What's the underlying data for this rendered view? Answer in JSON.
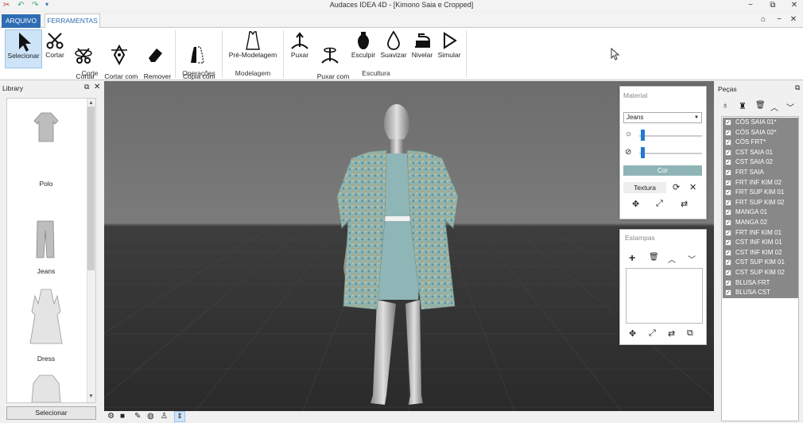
{
  "window": {
    "title": "Audaces IDEA 4D - [Kimono Saia e Cropped]",
    "controls": [
      "−",
      "⧉",
      "✕"
    ],
    "subcontrols": [
      "⌂",
      "−",
      "✕"
    ]
  },
  "tabs": {
    "file": "ARQUIVO",
    "tools": "FERRAMENTAS"
  },
  "ribbon": {
    "groups": {
      "corte": "Corte",
      "operacoes": "Operações",
      "modelagem": "Modelagem",
      "escultura": "Escultura"
    },
    "buttons": {
      "selecionar": "Selecionar",
      "cortar": "Cortar",
      "cortar_anel": "Cortar\ncom Anel",
      "cortar_curva": "Cortar com\nCurva",
      "remover_cortes": "Remover\ncortes",
      "copia_simetria": "Cópia com\nsimetria",
      "pre_modelagem": "Pré-Modelagem",
      "puxar": "Puxar",
      "puxar_anel": "Puxar com\nAnel",
      "esculpir": "Esculpir",
      "suavizar": "Suavizar",
      "nivelar": "Nivelar",
      "simular": "Simular"
    }
  },
  "library": {
    "title": "Library",
    "items": [
      "Polo",
      "Jeans",
      "Dress"
    ],
    "select_button": "Selecionar"
  },
  "material": {
    "title": "Material",
    "fabric": "Jeans",
    "color_button": "Cor",
    "texture_button": "Textura",
    "slider_brightness": 0.0,
    "slider_visibility": 0.0
  },
  "estampas": {
    "title": "Estampas"
  },
  "pieces": {
    "title": "Peças",
    "items": [
      "CÓS SAIA 01*",
      "CÓS SAIA 02*",
      "CÓS FRT*",
      "CST SAIA 01",
      "CST SAIA 02",
      "FRT SAIA",
      "FRT INF KIM 02",
      "FRT SUP KIM 01",
      "FRT SUP KIM 02",
      "MANGA 01",
      "MANGA 02",
      "FRT INF KIM 01",
      "CST INF KIM 01",
      "CST INF KIM 02",
      "CST SUP KIM 01",
      "CST SUP KIM 02",
      "BLUSA FRT",
      "BLUSA CST"
    ]
  },
  "colors": {
    "accent": "#2e6db4",
    "piece_bg": "#888888",
    "selected_btn": "#cde3f7"
  }
}
